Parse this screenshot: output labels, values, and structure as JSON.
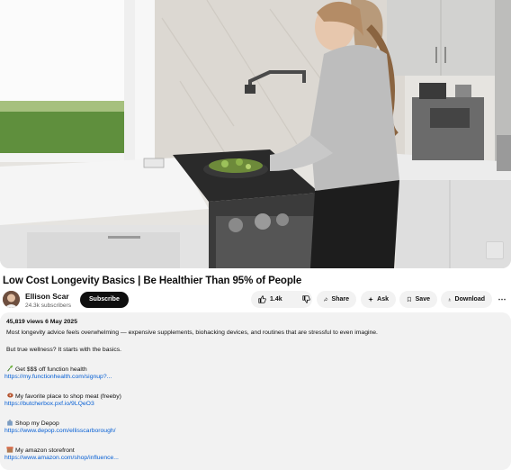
{
  "video": {
    "title": "Low Cost Longevity Basics | Be Healthier Than 95% of People"
  },
  "channel": {
    "name": "Ellison Scar",
    "subscribers": "24.3k subscribers",
    "subscribe_label": "Subscribe"
  },
  "actions": {
    "like_count": "1.4k",
    "share_label": "Share",
    "ask_label": "Ask",
    "save_label": "Save",
    "download_label": "Download",
    "more_label": "⋯"
  },
  "description": {
    "meta": "45,819 views  6 May 2025",
    "intro": "Most longevity advice feels overwhelming — expensive supplements, biohacking devices, and routines that are stressful to even imagine.",
    "wellness": "But true wellness? It starts with the basics.",
    "links": [
      {
        "label": "Get $$$ off function health",
        "url": "https://my.functionhealth.com/signup?...",
        "icon": "sprout-icon"
      },
      {
        "label": "My favorite place to shop meat (freeby)",
        "url": "https://butcherbox.pxf.io/9LQeO3",
        "icon": "meat-icon"
      },
      {
        "label": "Shop my Depop",
        "url": "https://www.depop.com/ellisscarborough/",
        "icon": "bag-icon"
      },
      {
        "label": "My amazon storefront",
        "url": "https://www.amazon.com/shop/influence...",
        "icon": "storefront-icon"
      }
    ]
  },
  "colors": {
    "link": "#065fd4",
    "subscribe_bg": "#0f0f0f",
    "pill_bg": "#f2f2f2",
    "desc_bg": "#f2f2f2"
  }
}
